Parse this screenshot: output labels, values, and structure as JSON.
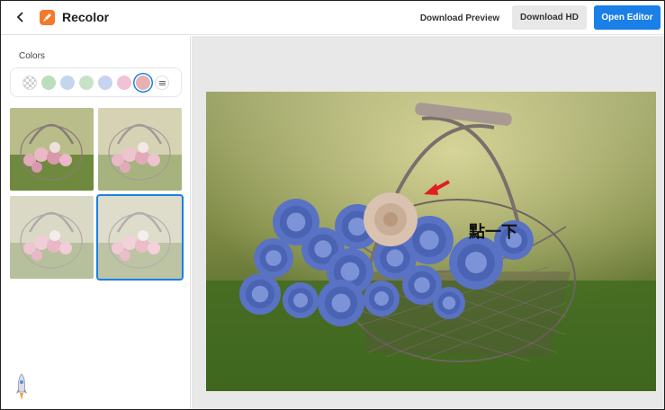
{
  "header": {
    "back_icon": "chevron-left-icon",
    "app_icon": "recolor-brush-icon",
    "title": "Recolor",
    "download_preview_label": "Download Preview",
    "download_hd_label": "Download HD",
    "open_editor_label": "Open Editor",
    "accent_color": "#1a7fe6"
  },
  "sidebar": {
    "colors_label": "Colors",
    "swatches": [
      {
        "name": "transparent",
        "color": "checker"
      },
      {
        "name": "mint",
        "color": "#b9dfbd"
      },
      {
        "name": "light-blue",
        "color": "#c4d6ee"
      },
      {
        "name": "pale-green",
        "color": "#c6e3c9"
      },
      {
        "name": "periwinkle",
        "color": "#c8d3f0"
      },
      {
        "name": "pink",
        "color": "#f1c2d6"
      },
      {
        "name": "rose",
        "color": "#e8b0b0",
        "selected": true
      },
      {
        "name": "more",
        "color": "more-icon"
      }
    ],
    "thumbnails": [
      {
        "name": "recolor-variant-1",
        "selected": false
      },
      {
        "name": "recolor-variant-2",
        "selected": false
      },
      {
        "name": "recolor-variant-3",
        "selected": false
      },
      {
        "name": "recolor-variant-4",
        "selected": true
      }
    ],
    "footer_icon": "rocket-icon"
  },
  "canvas": {
    "annotation_text": "點一下",
    "annotation_arrow_color": "#e02020",
    "rose_color": "#5a72c4",
    "highlighted_rose_color": "#d9c2b0"
  }
}
